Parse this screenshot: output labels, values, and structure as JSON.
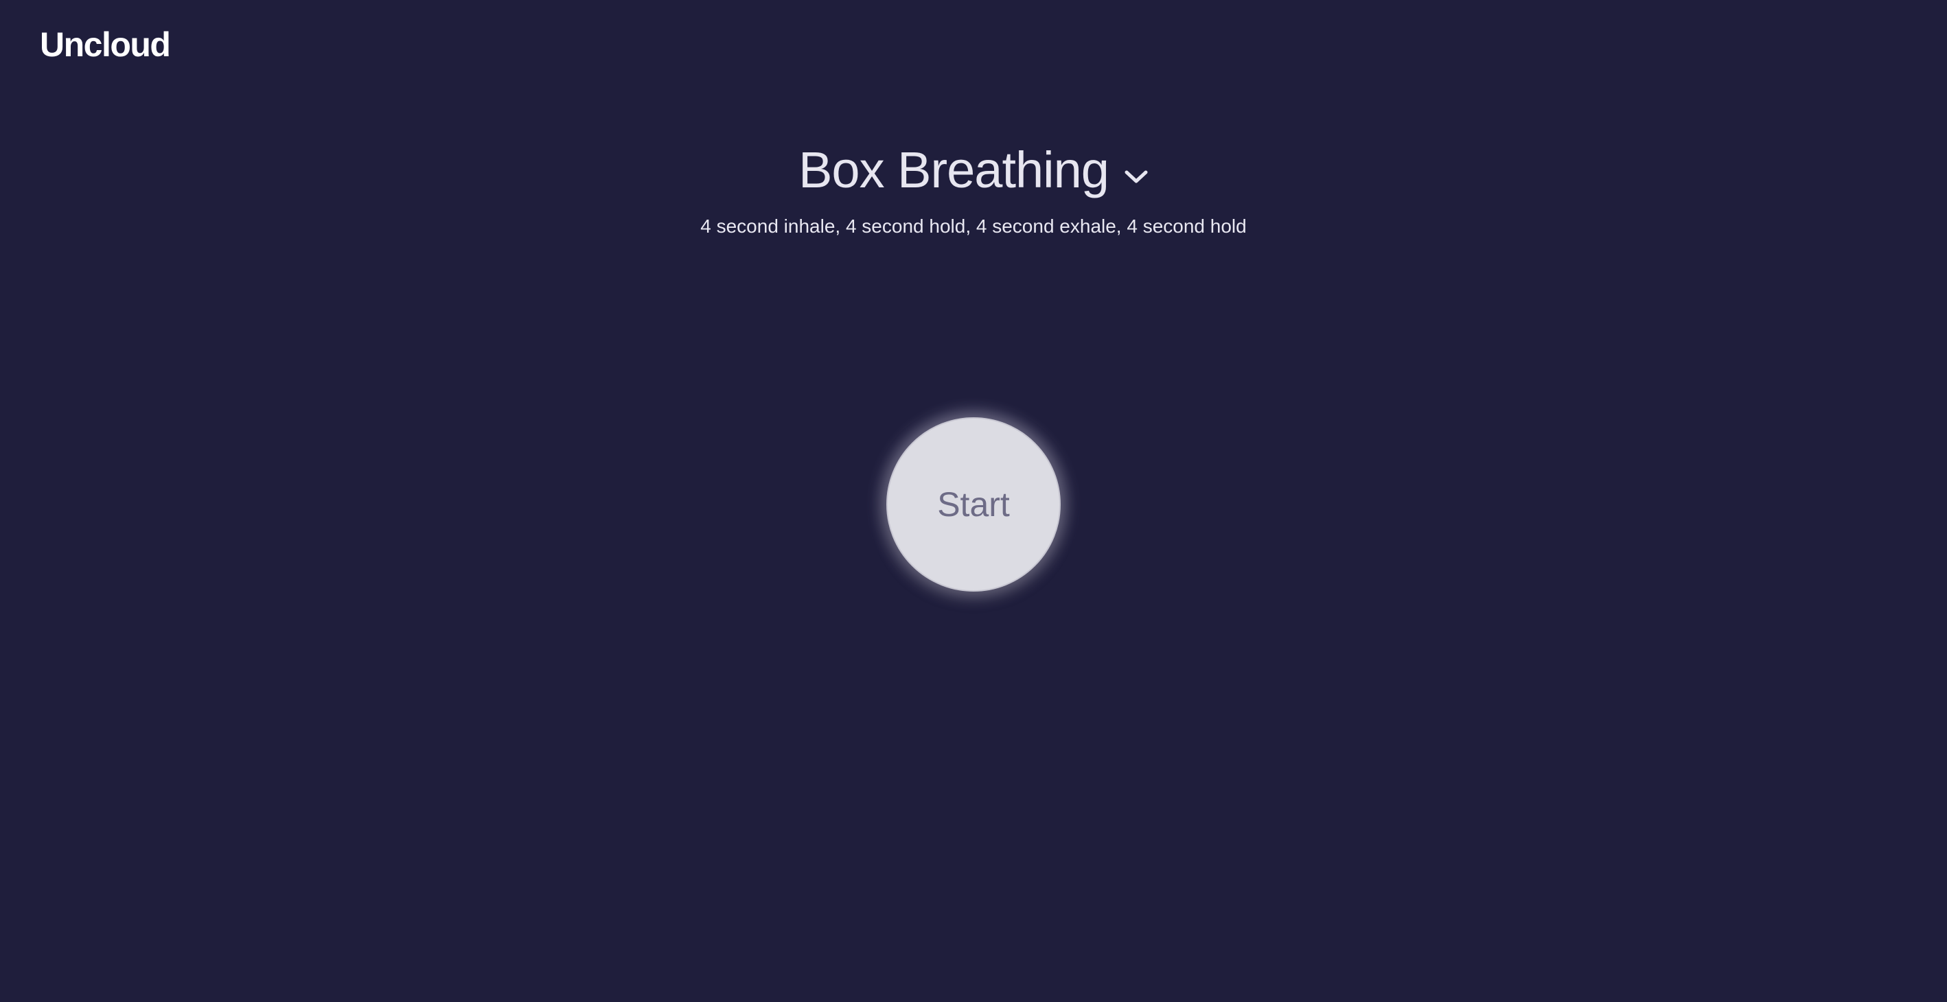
{
  "brand": {
    "name": "Uncloud"
  },
  "pattern": {
    "title": "Box Breathing",
    "selector_icon": "chevron-down-icon",
    "description": "4 second inhale, 4 second hold, 4 second exhale, 4 second hold"
  },
  "start_button": {
    "label": "Start"
  },
  "colors": {
    "background": "#1f1e3c",
    "text": "#e7e6f0",
    "button_fill": "#dcdce3",
    "button_text": "#6d6b86"
  }
}
